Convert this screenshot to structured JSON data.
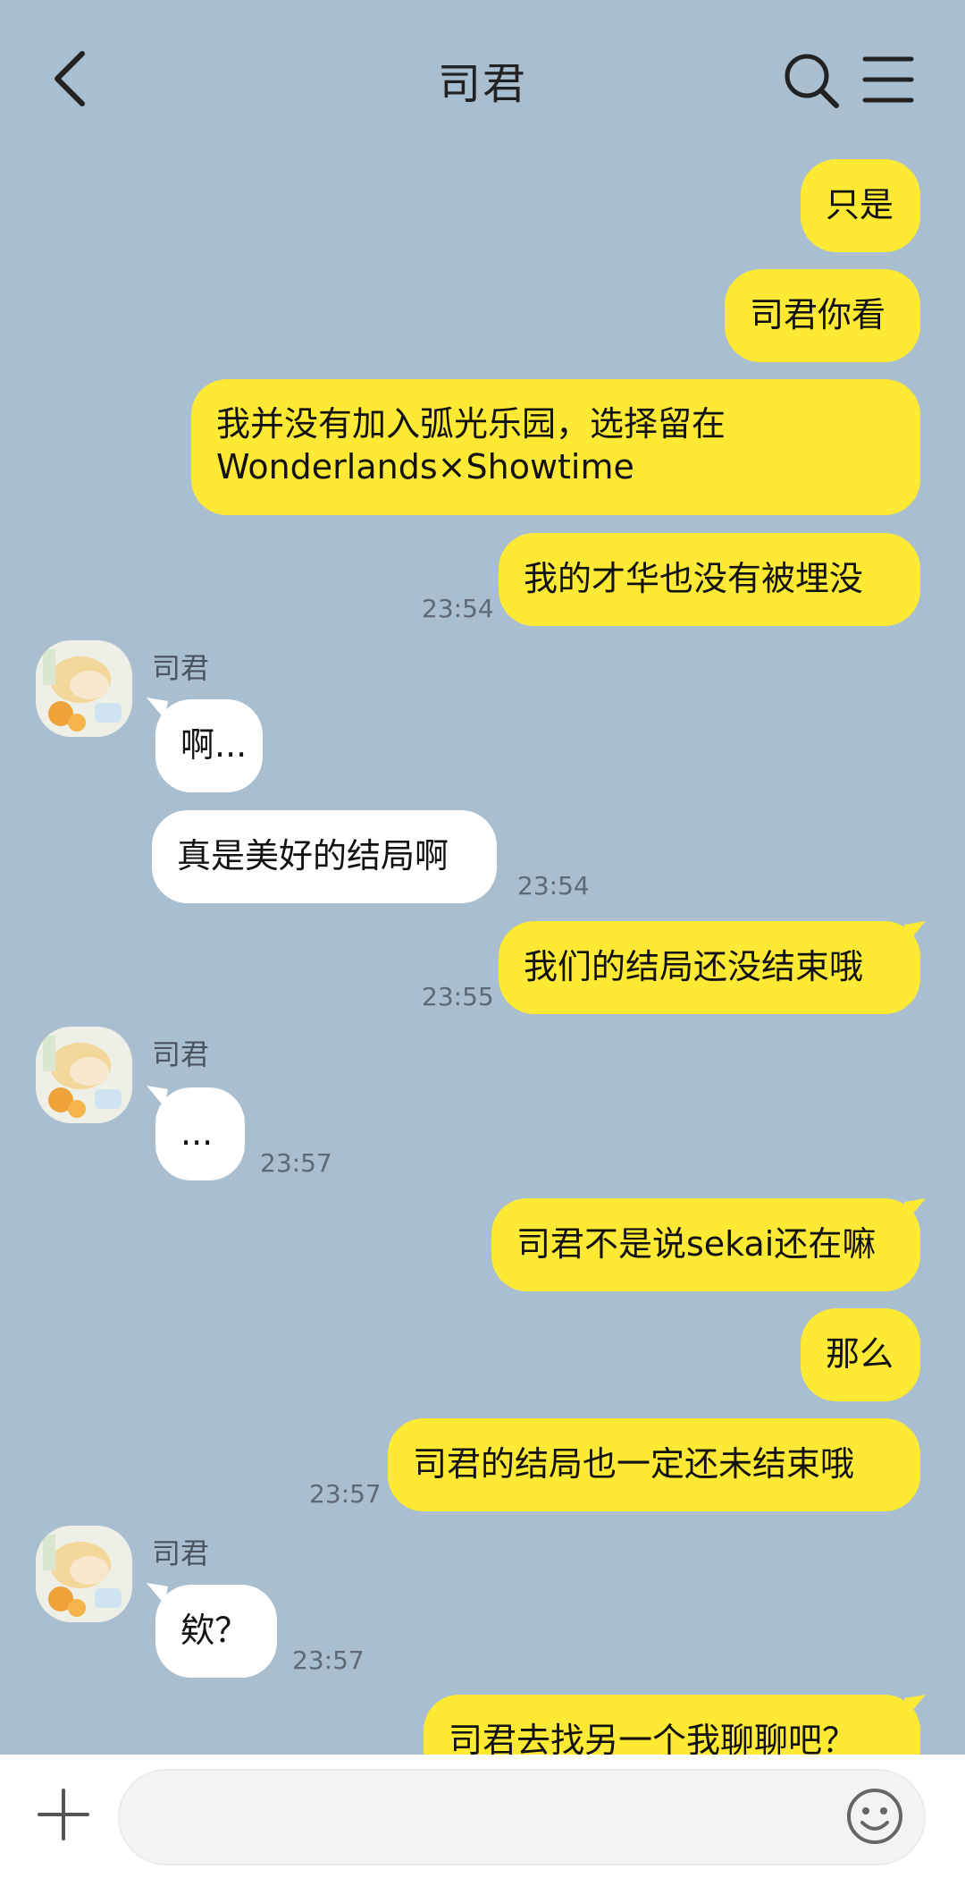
{
  "header": {
    "title": "司君"
  },
  "messages": [
    {
      "side": "me",
      "text": "只是"
    },
    {
      "side": "me",
      "text": "司君你看"
    },
    {
      "side": "me",
      "text_line1": "我并没有加入弧光乐园，选择留在",
      "text_line2": "Wonderlands×Showtime"
    },
    {
      "side": "me",
      "text": "我的才华也没有被埋没",
      "time": "23:54"
    },
    {
      "side": "them",
      "sender": "司君",
      "text": "啊..."
    },
    {
      "side": "them",
      "text": "真是美好的结局啊",
      "time": "23:54"
    },
    {
      "side": "me",
      "text": "我们的结局还没结束哦",
      "time": "23:55"
    },
    {
      "side": "them",
      "sender": "司君",
      "text": "...",
      "time": "23:57"
    },
    {
      "side": "me",
      "text": "司君不是说sekai还在嘛"
    },
    {
      "side": "me",
      "text": "那么"
    },
    {
      "side": "me",
      "text": "司君的结局也一定还未结束哦",
      "time": "23:57"
    },
    {
      "side": "them",
      "sender": "司君",
      "text": "欸？",
      "time": "23:57"
    },
    {
      "side": "me",
      "text": "司君去找另一个我聊聊吧？"
    }
  ],
  "input": {
    "value": "",
    "placeholder": ""
  },
  "icons": {
    "back": "chevron-left-icon",
    "search": "search-icon",
    "menu": "hamburger-menu-icon",
    "add": "plus-icon",
    "emoji": "smiley-icon"
  },
  "colors": {
    "background": "#a9bfd0",
    "my_bubble": "#fee934",
    "their_bubble": "#ffffff",
    "time_text": "#5d6a75"
  }
}
